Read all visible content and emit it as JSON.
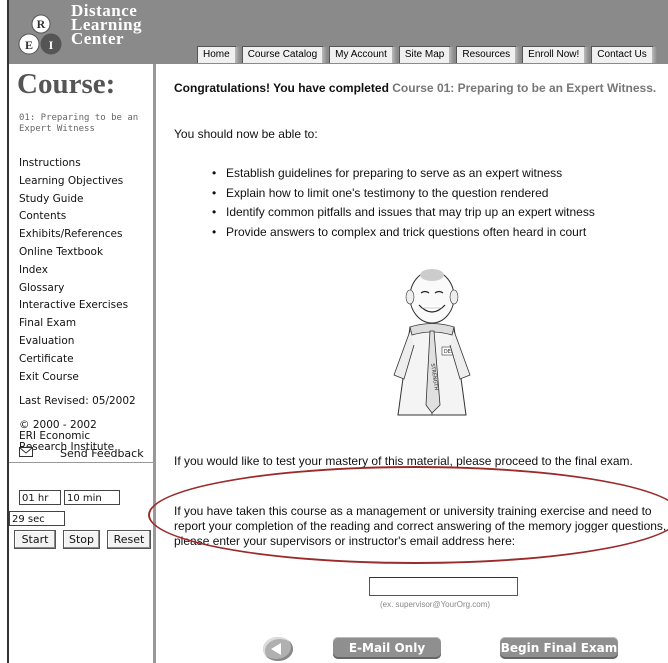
{
  "logo": {
    "line1": "Distance",
    "line2": "Learning",
    "line3": "Center",
    "letters": [
      "R",
      "E",
      "I"
    ]
  },
  "nav": [
    "Home",
    "Course Catalog",
    "My Account",
    "Site Map",
    "Resources",
    "Enroll Now!",
    "Contact Us"
  ],
  "sidebar": {
    "title": "Course:",
    "subtitle": "01: Preparing to be an Expert Witness",
    "links": [
      "Instructions",
      "Learning Objectives",
      "Study Guide",
      "Contents",
      "Exhibits/References",
      "Online Textbook",
      "Index",
      "Glossary",
      "Interactive Exercises",
      "Final Exam",
      "Evaluation",
      "Certificate",
      "Exit Course"
    ],
    "last_revised": "Last Revised: 05/2002",
    "copyright_line1": "© 2000 - 2002",
    "copyright_line2": "ERI Economic",
    "copyright_line3": "Research Institute",
    "feedback_label": "Send Feedback",
    "timer": {
      "hours": "01 hr",
      "minutes": "10 min",
      "seconds": "29 sec"
    },
    "buttons": {
      "start": "Start",
      "stop": "Stop",
      "reset": "Reset"
    }
  },
  "main": {
    "congrats_bold": "Congratulations! You have completed",
    "congrats_course": "Course 01: Preparing to be an Expert Witness.",
    "intro": "You should now be able to:",
    "objectives": [
      "Establish guidelines for preparing to serve as an expert witness",
      "Explain how to limit one's testimony to the question rendered",
      "Identify common pitfalls and issues that may trip up an expert witness",
      "Provide answers to complex and trick questions often heard in court"
    ],
    "badge_text": "DEK",
    "tie_text": "STRENGTH",
    "test_mastery": "If you would like to test your mastery of this material, please proceed to the final exam.",
    "report_text": "If you have taken this course as a management or university training exercise and need to report your completion of the reading and correct answering of the memory jogger questions, please enter your supervisors or instructor's email address here:",
    "email_placeholder": "",
    "email_hint": "(ex. supervisor@YourOrg.com)",
    "email_only": "E-Mail Only",
    "begin_exam": "Begin Final Exam"
  },
  "colors": {
    "header_grey": "#8a8a8a",
    "oval_red": "#9b2b2b",
    "course_grey": "#777777"
  }
}
